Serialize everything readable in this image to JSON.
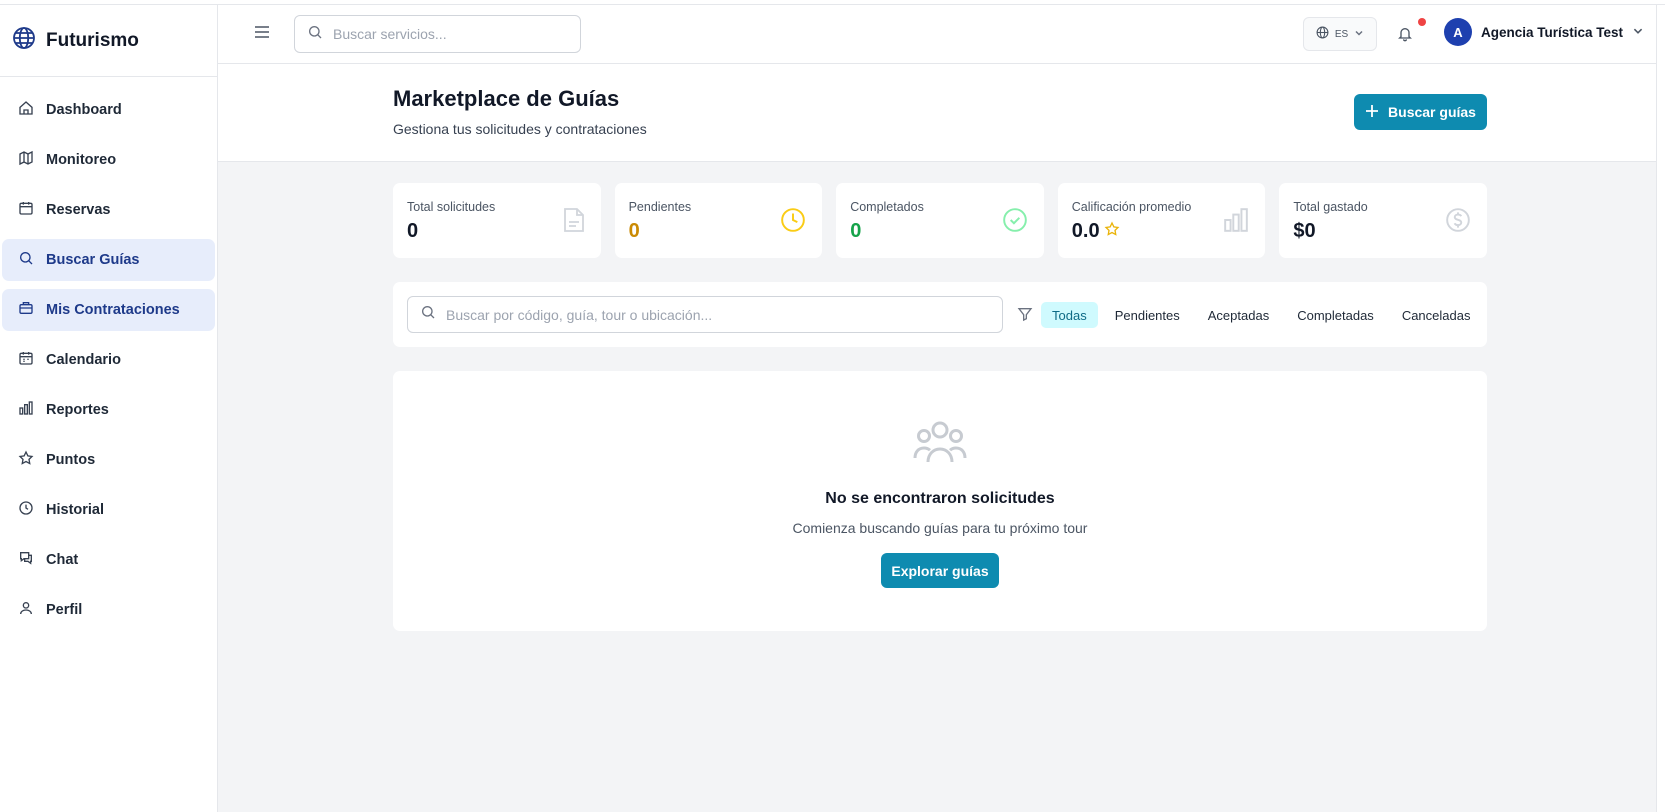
{
  "app": {
    "name": "Futurismo"
  },
  "sidebar": {
    "items": [
      {
        "label": "Dashboard",
        "icon": "home-icon",
        "active": false
      },
      {
        "label": "Monitoreo",
        "icon": "map-icon",
        "active": false
      },
      {
        "label": "Reservas",
        "icon": "calendar-icon",
        "active": false
      },
      {
        "label": "Buscar Guías",
        "icon": "search-icon",
        "active": true
      },
      {
        "label": "Mis Contrataciones",
        "icon": "briefcase-icon",
        "active": true
      },
      {
        "label": "Calendario",
        "icon": "calendar-days-icon",
        "active": false
      },
      {
        "label": "Reportes",
        "icon": "bar-chart-icon",
        "active": false
      },
      {
        "label": "Puntos",
        "icon": "star-icon",
        "active": false
      },
      {
        "label": "Historial",
        "icon": "clock-icon",
        "active": false
      },
      {
        "label": "Chat",
        "icon": "chat-icon",
        "active": false
      },
      {
        "label": "Perfil",
        "icon": "user-icon",
        "active": false
      }
    ]
  },
  "topbar": {
    "search_placeholder": "Buscar servicios...",
    "language": "ES",
    "user_initial": "A",
    "user_name": "Agencia Turística Test"
  },
  "header": {
    "title": "Marketplace de Guías",
    "subtitle": "Gestiona tus solicitudes y contrataciones",
    "primary_button": "Buscar guías"
  },
  "stats": [
    {
      "label": "Total solicitudes",
      "value": "0",
      "color": "#111827",
      "icon": "document-icon"
    },
    {
      "label": "Pendientes",
      "value": "0",
      "color": "#ca8a04",
      "icon": "clock-icon"
    },
    {
      "label": "Completados",
      "value": "0",
      "color": "#16a34a",
      "icon": "check-circle-icon"
    },
    {
      "label": "Calificación promedio",
      "value": "0.0",
      "color": "#111827",
      "icon": "bar-chart-icon"
    },
    {
      "label": "Total gastado",
      "value": "$0",
      "color": "#111827",
      "icon": "dollar-icon"
    }
  ],
  "filters": {
    "search_placeholder": "Buscar por código, guía, tour o ubicación...",
    "tabs": [
      {
        "label": "Todas",
        "active": true
      },
      {
        "label": "Pendientes",
        "active": false
      },
      {
        "label": "Aceptadas",
        "active": false
      },
      {
        "label": "Completadas",
        "active": false
      },
      {
        "label": "Canceladas",
        "active": false
      }
    ]
  },
  "empty_state": {
    "title": "No se encontraron solicitudes",
    "text": "Comienza buscando guías para tu próximo tour",
    "button": "Explorar guías"
  },
  "colors": {
    "accent": "#0e8bb0",
    "active_nav_bg": "#e7edfb",
    "active_tab_bg": "#cffafe",
    "notification_dot": "#ef4444"
  }
}
